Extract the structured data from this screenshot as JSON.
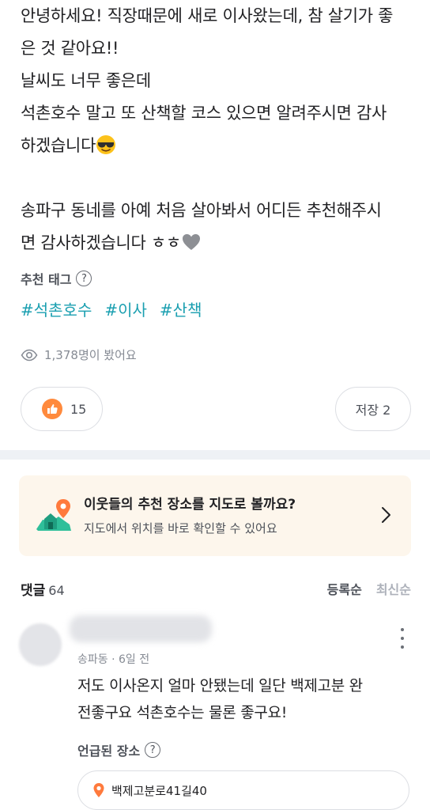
{
  "post": {
    "lines": [
      "안녕하세요! 직장때문에 새로 이사왔는데, 참 살기가 좋",
      "은 것 같아요!!",
      "날씨도 너무 좋은데",
      "석촌호수 말고 또 산책할 코스 있으면 알려주시면 감사",
      "하겠습니다",
      "",
      "송파구 동네를 아예 처음 살아봐서 어디든 추천해주시",
      "면 감사하겠습니다 ㅎㅎ"
    ],
    "emoji_after_line5": "smiling-face-with-sunglasses",
    "emoji_after_line8": "grey-heart"
  },
  "tags": {
    "title": "추천 태그",
    "help": "?",
    "items": [
      "#석촌호수",
      "#이사",
      "#산책"
    ],
    "color": "#1a9fb0"
  },
  "views": {
    "text": "1,378명이 봤어요",
    "icon": "eye-icon"
  },
  "actions": {
    "like_count": "15",
    "like_icon": "thumbs-up-icon",
    "save_label": "저장 2"
  },
  "banner": {
    "title": "이웃들의 추천 장소를 지도로 볼까요?",
    "subtitle": "지도에서 위치를 바로 확인할 수 있어요",
    "icon": "map-pin-house-icon"
  },
  "comments": {
    "title": "댓글",
    "count": "64",
    "sort_options": [
      "등록순",
      "최신순"
    ],
    "items": [
      {
        "meta": "송파동 · 6일 전",
        "text_line1": "저도 이사온지 얼마 안됐는데 일단 백제고분 완",
        "text_line2": "전좋구요 석촌호수는 물론 좋구요!",
        "mention_title": "언급된 장소",
        "place": "백제고분로41길40"
      }
    ]
  },
  "colors": {
    "accent": "#ff8a3d",
    "tag": "#1a9fb0",
    "banner_bg": "#fdf6ec"
  }
}
